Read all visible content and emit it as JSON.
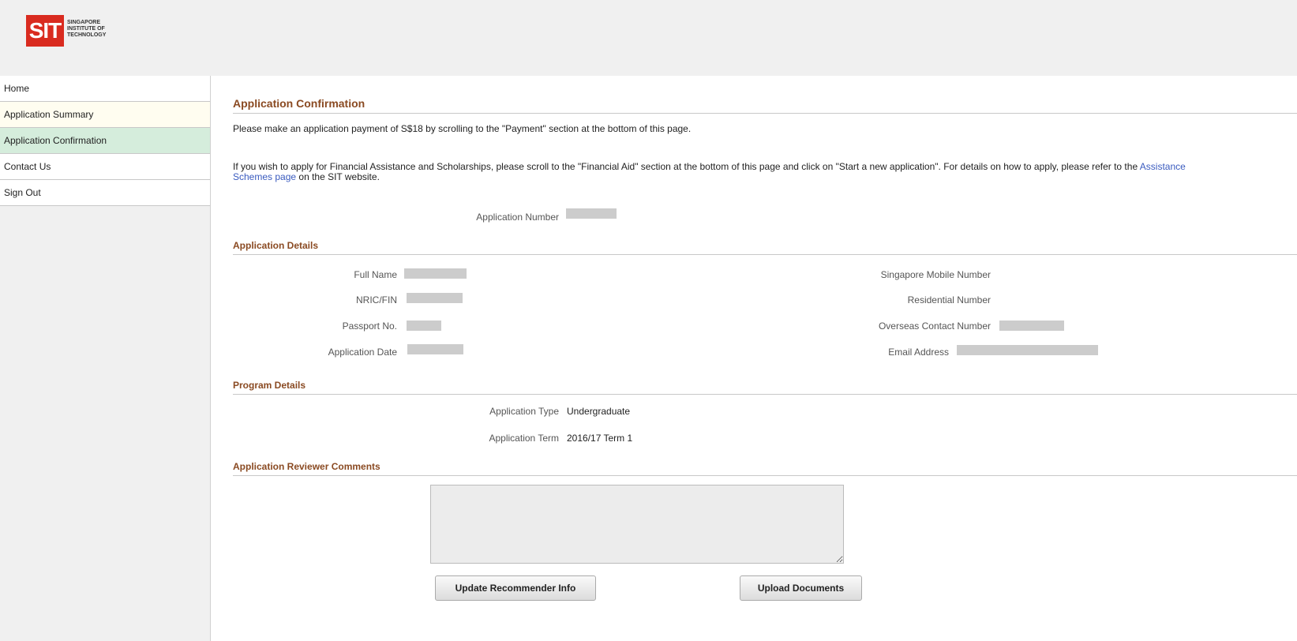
{
  "header": {
    "logo_mark": "SIT",
    "logo_line1": "SINGAPORE",
    "logo_line2": "INSTITUTE OF",
    "logo_line3": "TECHNOLOGY"
  },
  "sidebar": {
    "items": [
      {
        "label": "Home"
      },
      {
        "label": "Application Summary"
      },
      {
        "label": "Application Confirmation"
      },
      {
        "label": "Contact Us"
      },
      {
        "label": "Sign Out"
      }
    ]
  },
  "confirmation": {
    "title": "Application Confirmation",
    "payment_text": "Please make an application payment of S$18 by scrolling to the \"Payment\" section at the bottom of this page.",
    "aid_text": "If you wish to apply for Financial Assistance and Scholarships, please scroll to the \"Financial Aid\" section at the bottom of this page and click on \"Start a new application\". For details on how to apply, please refer to the",
    "aid_link": "Assistance Schemes page",
    "aid_suffix": " on the SIT website.",
    "app_number_label": "Application Number"
  },
  "details": {
    "title": "Application Details",
    "full_name_label": "Full Name",
    "nric_label": "NRIC/FIN",
    "passport_label": "Passport No.",
    "app_date_label": "Application Date",
    "mobile_label": "Singapore Mobile Number",
    "residential_label": "Residential Number",
    "overseas_label": "Overseas Contact Number",
    "email_label": "Email Address"
  },
  "program": {
    "title": "Program Details",
    "type_label": "Application Type",
    "type_value": "Undergraduate",
    "term_label": "Application Term",
    "term_value": "2016/17 Term 1"
  },
  "reviewer": {
    "title": "Application Reviewer Comments",
    "comments_value": ""
  },
  "buttons": {
    "update_recommender": "Update Recommender Info",
    "upload_documents": "Upload Documents"
  },
  "colors": {
    "section_title": "#8a4a22",
    "active_nav": "#d5eddc",
    "summary_nav": "#fffdf0",
    "link": "#3a5bbf",
    "logo_red": "#d92b1f"
  }
}
